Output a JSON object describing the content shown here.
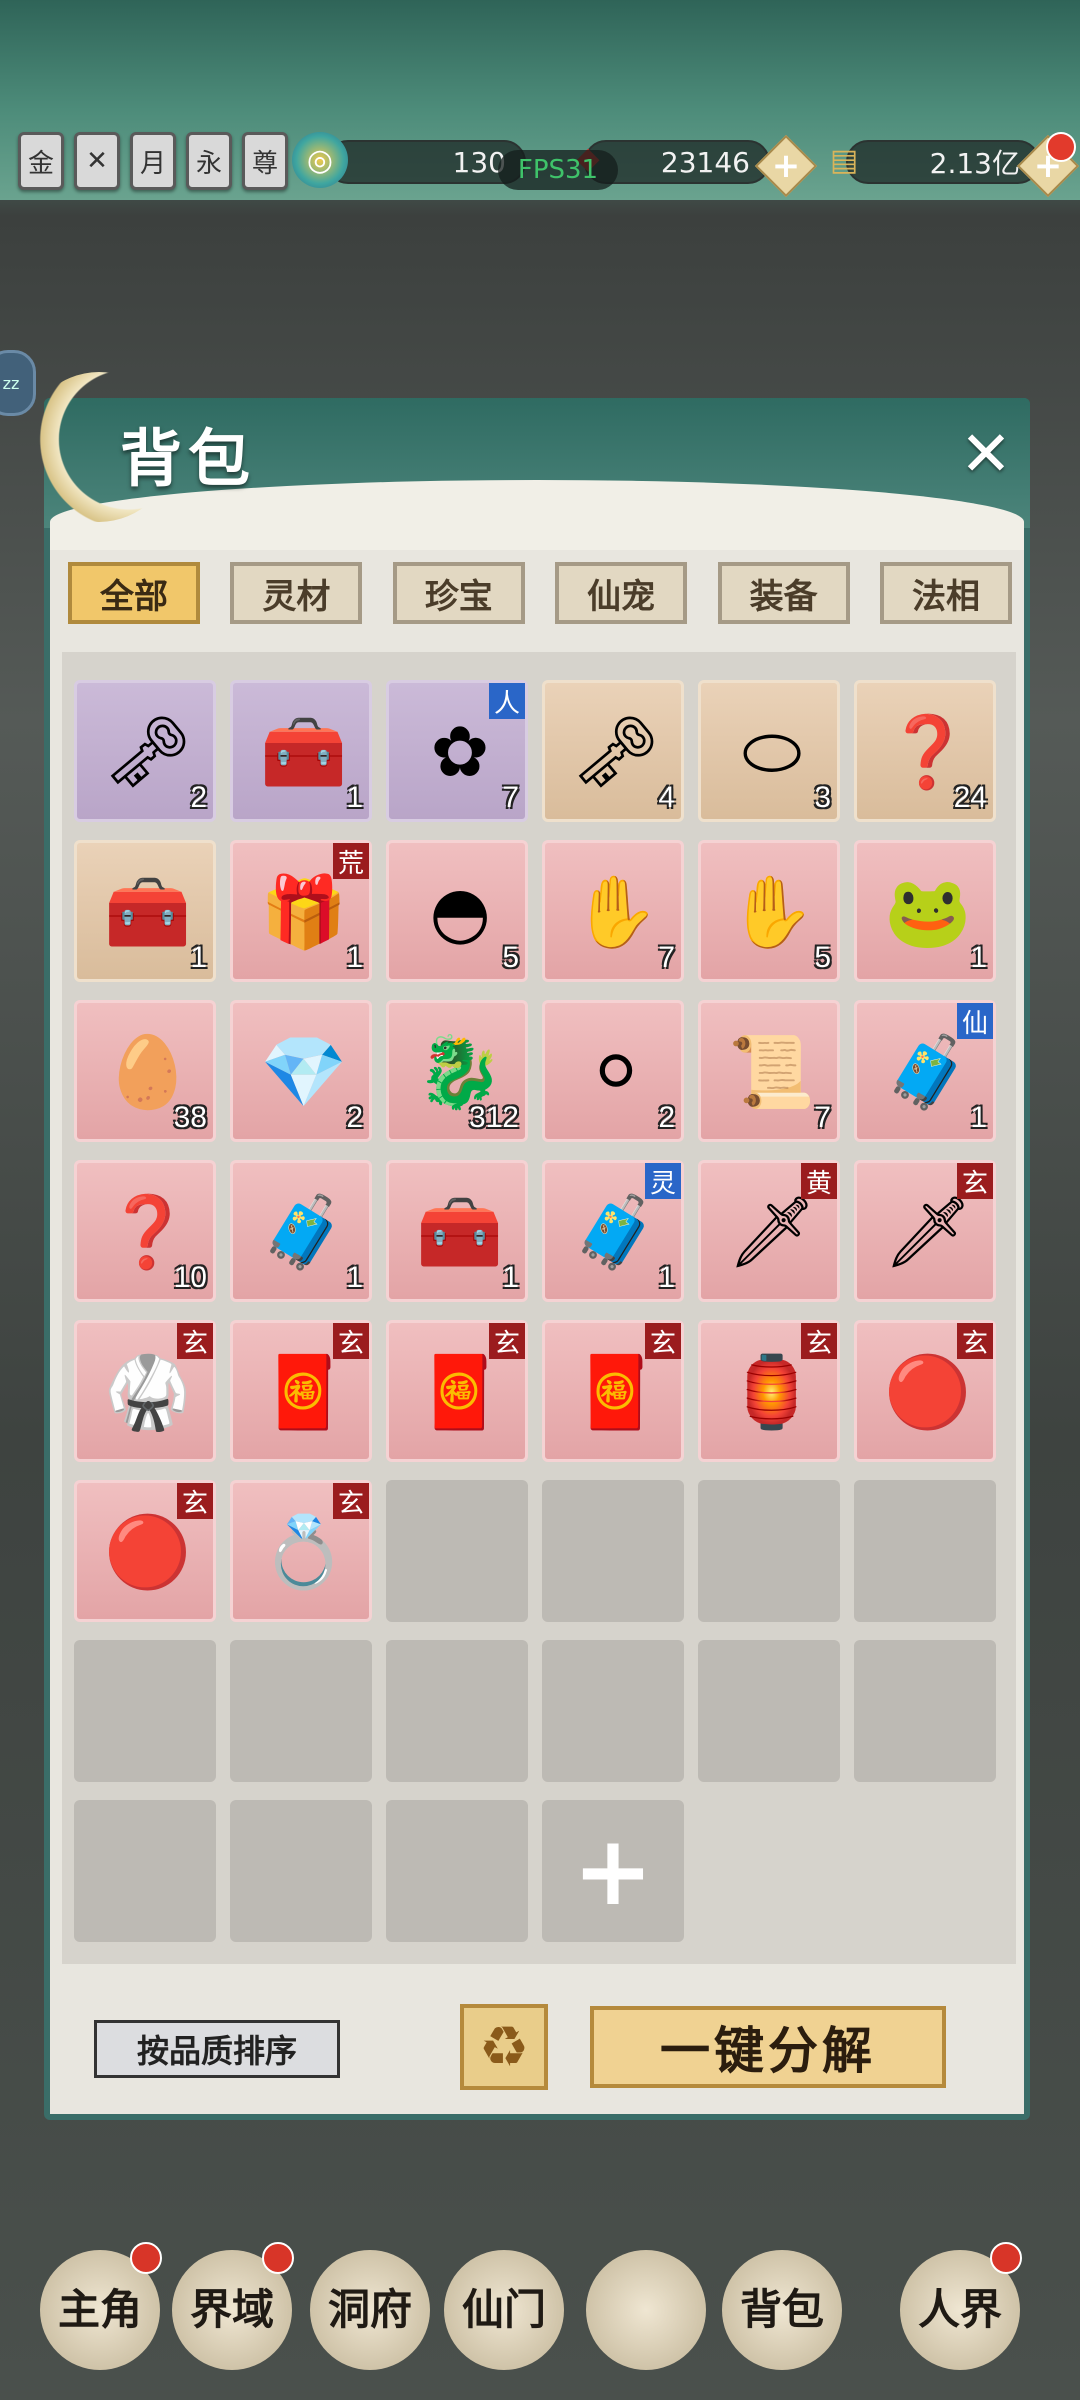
{
  "top": {
    "badges": [
      "金",
      "",
      "月",
      "永",
      "尊"
    ],
    "resources": [
      {
        "icon": "jade-swirl-icon",
        "value": "130"
      },
      {
        "icon": "red-crystal-icon",
        "value": "23146"
      },
      {
        "icon": "scroll-icon",
        "value": "2.13亿"
      }
    ],
    "fps": "FPS31",
    "side_tab": "zz"
  },
  "panel": {
    "title": "背包",
    "close": "✕"
  },
  "tabs": [
    {
      "label": "全部",
      "active": true
    },
    {
      "label": "灵材",
      "active": false
    },
    {
      "label": "珍宝",
      "active": false
    },
    {
      "label": "仙宠",
      "active": false
    },
    {
      "label": "装备",
      "active": false
    },
    {
      "label": "法相",
      "active": false
    }
  ],
  "items": [
    {
      "rarity": "purple",
      "icon": "fire-key-icon",
      "glyph": "🗝",
      "count": "2",
      "tag": ""
    },
    {
      "rarity": "purple",
      "icon": "blue-box-icon",
      "glyph": "🧰",
      "count": "1",
      "tag": ""
    },
    {
      "rarity": "purple",
      "icon": "blue-flower-icon",
      "glyph": "✿",
      "count": "7",
      "tag": "人",
      "tagColor": "blue"
    },
    {
      "rarity": "tan",
      "icon": "fire-key-icon",
      "glyph": "🗝",
      "count": "4",
      "tag": ""
    },
    {
      "rarity": "tan",
      "icon": "stone-tablet-icon",
      "glyph": "⬭",
      "count": "3",
      "tag": ""
    },
    {
      "rarity": "tan",
      "icon": "mystery-box-icon",
      "glyph": "❓",
      "count": "24",
      "tag": ""
    },
    {
      "rarity": "tan",
      "icon": "blue-box-icon",
      "glyph": "🧰",
      "count": "1",
      "tag": ""
    },
    {
      "rarity": "pink",
      "icon": "gold-chest-icon",
      "glyph": "🎁",
      "count": "1",
      "tag": "荒",
      "tagColor": "red"
    },
    {
      "rarity": "pink",
      "icon": "white-bowl-icon",
      "glyph": "◓",
      "count": "5",
      "tag": ""
    },
    {
      "rarity": "pink",
      "icon": "orange-talisman-icon",
      "glyph": "✋",
      "count": "7",
      "tag": ""
    },
    {
      "rarity": "pink",
      "icon": "blue-talisman-icon",
      "glyph": "✋",
      "count": "5",
      "tag": ""
    },
    {
      "rarity": "pink",
      "icon": "jade-beast-icon",
      "glyph": "🐸",
      "count": "1",
      "tag": ""
    },
    {
      "rarity": "pink",
      "icon": "pink-egg-icon",
      "glyph": "🥚",
      "count": "38",
      "tag": ""
    },
    {
      "rarity": "pink",
      "icon": "crystal-cushion-icon",
      "glyph": "💎",
      "count": "2",
      "tag": ""
    },
    {
      "rarity": "pink",
      "icon": "fire-dragon-icon",
      "glyph": "🐉",
      "count": "312",
      "tag": ""
    },
    {
      "rarity": "pink",
      "icon": "pearls-icon",
      "glyph": "⚪",
      "count": "2",
      "tag": ""
    },
    {
      "rarity": "pink",
      "icon": "remnant-scroll-icon",
      "glyph": "📜",
      "count": "7",
      "tag": ""
    },
    {
      "rarity": "pink",
      "icon": "blue-chest-icon",
      "glyph": "🧳",
      "count": "1",
      "tag": "仙",
      "tagColor": "blue"
    },
    {
      "rarity": "pink",
      "icon": "mystery-box-icon",
      "glyph": "❓",
      "count": "10",
      "tag": ""
    },
    {
      "rarity": "pink",
      "icon": "green-chest-icon",
      "glyph": "🧳",
      "count": "1",
      "tag": ""
    },
    {
      "rarity": "pink",
      "icon": "blue-box-icon",
      "glyph": "🧰",
      "count": "1",
      "tag": ""
    },
    {
      "rarity": "pink",
      "icon": "blue-chest-icon",
      "glyph": "🧳",
      "count": "1",
      "tag": "灵",
      "tagColor": "blue"
    },
    {
      "rarity": "pink",
      "icon": "red-sword-icon",
      "glyph": "🗡",
      "count": "",
      "tag": "黄",
      "tagColor": "red"
    },
    {
      "rarity": "pink",
      "icon": "red-sword-icon",
      "glyph": "🗡",
      "count": "",
      "tag": "玄",
      "tagColor": "red"
    },
    {
      "rarity": "pink",
      "icon": "red-armor-icon",
      "glyph": "🥋",
      "count": "",
      "tag": "玄",
      "tagColor": "red"
    },
    {
      "rarity": "pink",
      "icon": "red-talisman-icon",
      "glyph": "🧧",
      "count": "",
      "tag": "玄",
      "tagColor": "red"
    },
    {
      "rarity": "pink",
      "icon": "red-talisman-icon",
      "glyph": "🧧",
      "count": "",
      "tag": "玄",
      "tagColor": "red"
    },
    {
      "rarity": "pink",
      "icon": "red-talisman-icon",
      "glyph": "🧧",
      "count": "",
      "tag": "玄",
      "tagColor": "red"
    },
    {
      "rarity": "pink",
      "icon": "red-seal-icon",
      "glyph": "🏮",
      "count": "",
      "tag": "玄",
      "tagColor": "red"
    },
    {
      "rarity": "pink",
      "icon": "red-jade-pendant-icon",
      "glyph": "🔴",
      "count": "",
      "tag": "玄",
      "tagColor": "red"
    },
    {
      "rarity": "pink",
      "icon": "red-jade-pendant-icon",
      "glyph": "🔴",
      "count": "",
      "tag": "玄",
      "tagColor": "red"
    },
    {
      "rarity": "pink",
      "icon": "red-ring-icon",
      "glyph": "💍",
      "count": "",
      "tag": "玄",
      "tagColor": "red"
    }
  ],
  "empty_slots": 13,
  "add_slot": "+",
  "buttons": {
    "sort": "按品质排序",
    "recycle_icon": "recycle-icon",
    "decompose": "一键分解"
  },
  "nav": [
    {
      "label": "主角",
      "dot": true
    },
    {
      "label": "界域",
      "dot": true
    },
    {
      "label": "洞府",
      "dot": false
    },
    {
      "label": "仙门",
      "dot": false
    },
    {
      "label": "",
      "dot": false
    },
    {
      "label": "背包",
      "dot": false
    },
    {
      "label": "人界",
      "dot": true
    }
  ]
}
